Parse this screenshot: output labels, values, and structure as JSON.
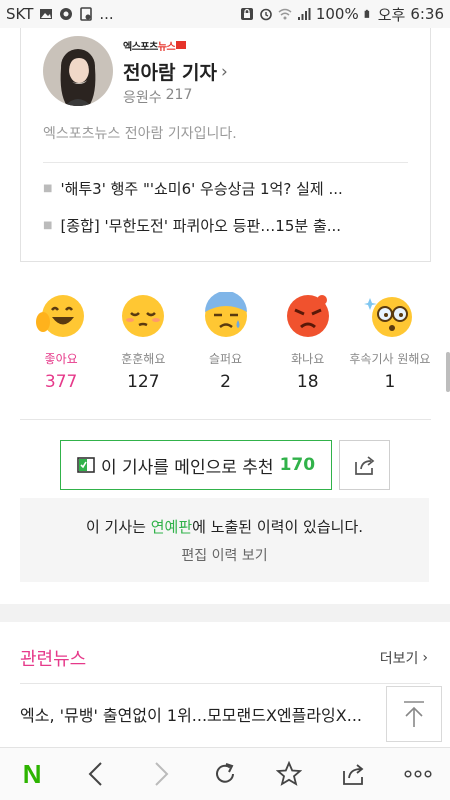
{
  "status_bar": {
    "carrier": "SKT",
    "more": "...",
    "battery": "100%",
    "ampm": "오후",
    "time": "6:36"
  },
  "reporter": {
    "brand_prefix": "엑스포츠",
    "brand_suffix": "뉴스",
    "name": "전아람 기자",
    "supporters_label": "응원수",
    "supporters_count": "217",
    "description": "엑스포츠뉴스 전아람 기자입니다.",
    "headlines": [
      "'해투3' 행주 \"'쇼미6' 우승상금 1억? 실제 ...",
      "[종합] '무한도전' 파퀴아오 등판…15분 출..."
    ]
  },
  "reactions": [
    {
      "icon": "like-face-icon",
      "label": "좋아요",
      "count": "377",
      "active": true
    },
    {
      "icon": "warm-face-icon",
      "label": "훈훈해요",
      "count": "127",
      "active": false
    },
    {
      "icon": "sad-face-icon",
      "label": "슬퍼요",
      "count": "2",
      "active": false
    },
    {
      "icon": "angry-face-icon",
      "label": "화나요",
      "count": "18",
      "active": false
    },
    {
      "icon": "want-followup-face-icon",
      "label": "후속기사 원해요",
      "count": "1",
      "active": false
    }
  ],
  "recommend": {
    "label": "이 기사를 메인으로 추천",
    "count": "170"
  },
  "notice": {
    "prefix": "이 기사는 ",
    "highlight": "연예판",
    "suffix": "에 노출된 이력이 있습니다.",
    "link": "편집 이력 보기"
  },
  "related": {
    "title": "관련뉴스",
    "more": "더보기",
    "items": [
      "엑소, '뮤뱅' 출연없이 1위...모모랜드X엔플라잉X..."
    ]
  },
  "colors": {
    "accent_pink": "#e6398a",
    "naver_green": "#2db400",
    "recommend_green": "#31b24a",
    "brand_red": "#e6332a"
  },
  "toolbar": [
    "naver-home-icon",
    "back-icon",
    "forward-icon",
    "refresh-icon",
    "bookmark-star-icon",
    "share-icon",
    "more-icon"
  ]
}
